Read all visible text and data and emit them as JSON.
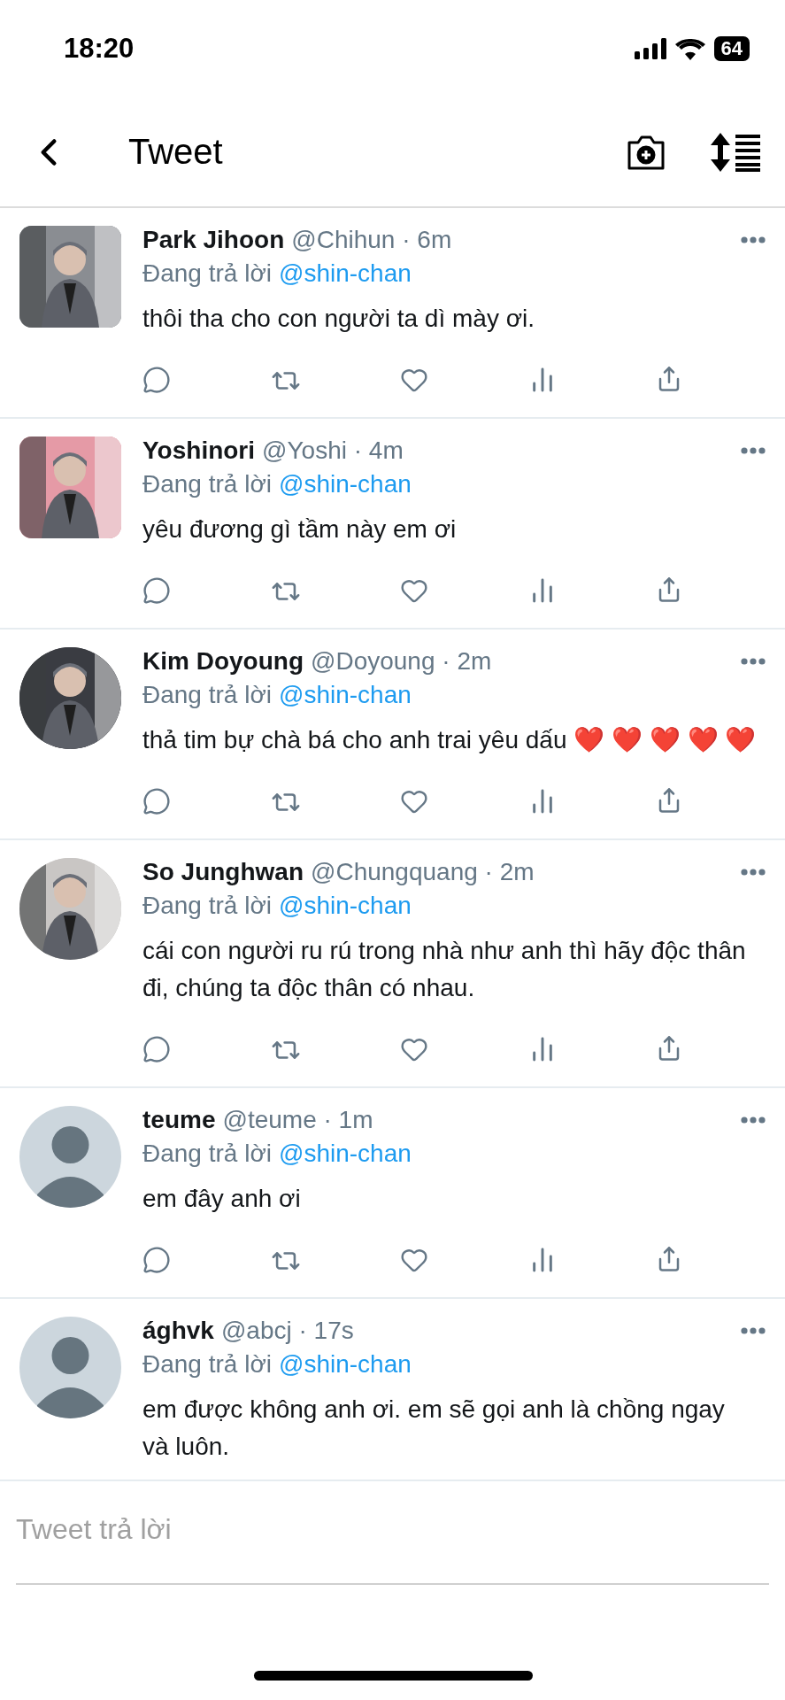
{
  "status_bar": {
    "time": "18:20",
    "battery": "64"
  },
  "header": {
    "title": "Tweet"
  },
  "tweets": [
    {
      "name": "Park Jihoon",
      "handle": "@Chihun",
      "time": "· 6m",
      "reply_prefix": "Đang trả lời",
      "reply_to": "@shin-chan",
      "text": "thôi tha cho con người ta dì mày ơi.",
      "avatar": {
        "kind": "picture",
        "round": false,
        "color": "#8a8d92"
      },
      "actions": true
    },
    {
      "name": "Yoshinori",
      "handle": "@Yoshi",
      "time": "· 4m",
      "reply_prefix": "Đang trả lời",
      "reply_to": "@shin-chan",
      "text": "yêu đương gì tầm này em ơi",
      "avatar": {
        "kind": "picture",
        "round": false,
        "color": "#e59aa6"
      },
      "actions": true
    },
    {
      "name": "Kim Doyoung",
      "handle": "@Doyoung",
      "time": "· 2m",
      "reply_prefix": "Đang trả lời",
      "reply_to": "@shin-chan",
      "text": "thả tim bự chà bá cho anh trai yêu dấu ❤️ ❤️ ❤️ ❤️ ❤️",
      "avatar": {
        "kind": "picture",
        "round": true,
        "color": "#3a3c42"
      },
      "actions": true
    },
    {
      "name": "So Junghwan",
      "handle": "@Chungquang",
      "time": "· 2m",
      "reply_prefix": "Đang trả lời",
      "reply_to": "@shin-chan",
      "text": "cái con người ru rú trong nhà như anh thì hãy độc thân đi, chúng ta độc thân có nhau.",
      "avatar": {
        "kind": "picture",
        "round": true,
        "color": "#c9c6c4"
      },
      "actions": true
    },
    {
      "name": "teume",
      "handle": "@teume",
      "time": "· 1m",
      "reply_prefix": "Đang trả lời",
      "reply_to": "@shin-chan",
      "text": "em đây anh ơi",
      "avatar": {
        "kind": "default",
        "round": true,
        "color": "#ccd6dd"
      },
      "actions": true
    },
    {
      "name": "ághvk",
      "handle": "@abcj",
      "time": "· 17s",
      "reply_prefix": "Đang trả lời",
      "reply_to": "@shin-chan",
      "text": "em được không anh ơi. em sẽ gọi anh là chồng ngay và luôn.",
      "avatar": {
        "kind": "default",
        "round": true,
        "color": "#ccd6dd"
      },
      "actions": false
    }
  ],
  "reply_box": {
    "placeholder": "Tweet trả lời"
  }
}
